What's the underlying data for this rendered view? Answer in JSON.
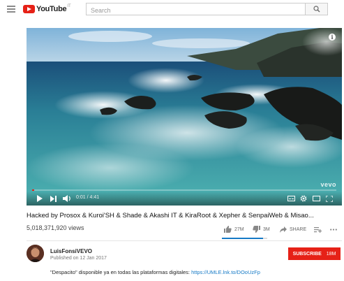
{
  "header": {
    "logo_text": "YouTube",
    "logo_region": "IT",
    "search_placeholder": "Search"
  },
  "player": {
    "time_current": "0:01",
    "time_separator": "/",
    "time_total": "4:41",
    "watermark": "vevo",
    "info_label": "i",
    "progress_fraction": 0.004
  },
  "video": {
    "title": "Hacked by Prosox & Kuroi'SH & Shade & Akashi IT & KiraRoot & Xepher & SenpaiWeb & Misao...",
    "views": "5,018,371,920 views",
    "likes": "27M",
    "dislikes": "3M",
    "share_label": "SHARE",
    "like_ratio": 0.9
  },
  "channel": {
    "name": "LuisFonsiVEVO",
    "published": "Published on 12 Jan 2017",
    "subscribe_label": "SUBSCRIBE",
    "subscriber_count": "18M"
  },
  "description": {
    "text": "\"Despacito\" disponible ya en todas las plataformas digitales: ",
    "link": "https://UMLE.lnk.to/DOoUzFp"
  },
  "colors": {
    "brand_red": "#e62117",
    "link_blue": "#167ac6"
  },
  "icons": [
    "menu-icon",
    "youtube-logo-icon",
    "search-icon",
    "info-icon",
    "play-icon",
    "next-icon",
    "volume-icon",
    "subtitles-icon",
    "settings-icon",
    "theater-icon",
    "fullscreen-icon",
    "thumbs-up-icon",
    "thumbs-down-icon",
    "share-icon",
    "add-to-playlist-icon",
    "more-icon"
  ]
}
